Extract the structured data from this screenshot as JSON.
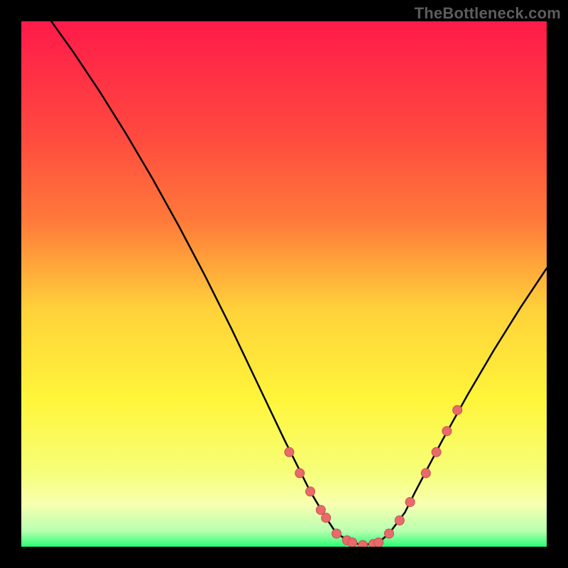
{
  "watermark": "TheBottleneck.com",
  "colors": {
    "background": "#000000",
    "gradient_top": "#ff1a4a",
    "gradient_mid_upper": "#ff7a3a",
    "gradient_mid": "#ffd23a",
    "gradient_lower": "#fff53a",
    "gradient_pale": "#f7ffb0",
    "gradient_bottom": "#2aff74",
    "curve": "#000000",
    "dot_fill": "#e86a6a",
    "dot_stroke": "#c94f4f"
  },
  "chart_data": {
    "type": "line",
    "title": "",
    "xlabel": "",
    "ylabel": "",
    "xlim": [
      0,
      100
    ],
    "ylim": [
      0,
      100
    ],
    "curve": {
      "name": "bottleneck-curve",
      "x": [
        0,
        5,
        10,
        15,
        20,
        25,
        30,
        35,
        40,
        45,
        50,
        55,
        58,
        60,
        63,
        65,
        68,
        70,
        73,
        75,
        80,
        85,
        90,
        95,
        100
      ],
      "y": [
        108,
        101,
        94,
        86.5,
        78.5,
        70,
        61,
        51.5,
        41.5,
        31,
        20.5,
        10.5,
        5.5,
        2.5,
        0.8,
        0.3,
        0.8,
        2.5,
        6.5,
        10.5,
        20,
        29,
        37.5,
        45.5,
        53
      ]
    },
    "dots": {
      "name": "highlight-dots",
      "x": [
        51,
        53,
        55,
        57,
        58,
        60,
        62,
        63,
        65,
        67,
        68,
        70,
        72,
        74,
        77,
        79,
        81,
        83
      ],
      "y": [
        18,
        14,
        10.5,
        7,
        5.5,
        2.5,
        1.2,
        0.8,
        0.3,
        0.5,
        0.8,
        2.5,
        5,
        8.5,
        14,
        18,
        22,
        26
      ]
    }
  }
}
